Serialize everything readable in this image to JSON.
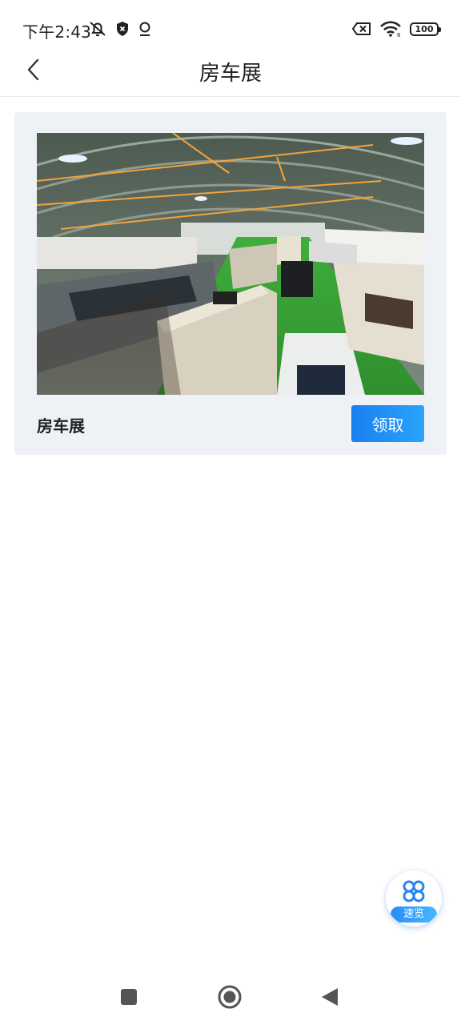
{
  "status_bar": {
    "time": "下午2:43",
    "battery": "100",
    "wifi_badge": "6"
  },
  "header": {
    "title": "房车展",
    "back_icon": "chevron-left-icon"
  },
  "card": {
    "title": "房车展",
    "claim_label": "领取",
    "image_subject": "rv-exhibition-hall-photo"
  },
  "floating_button": {
    "label": "速览",
    "icon": "clover-icon"
  },
  "colors": {
    "accent": "#1a7ff0",
    "card_bg": "#eef2f7",
    "text": "#222222"
  }
}
